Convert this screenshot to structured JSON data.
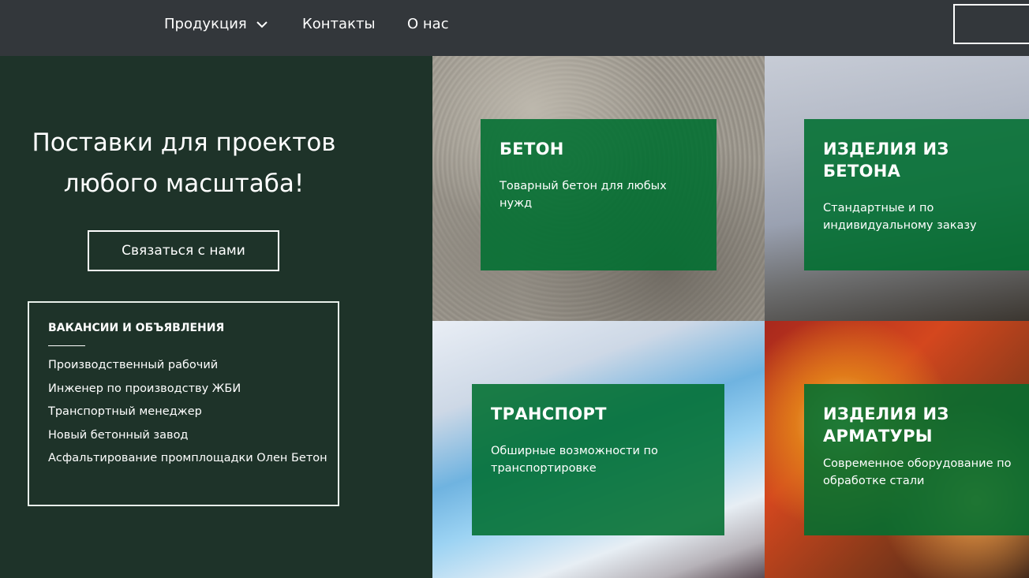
{
  "nav": {
    "products": "Продукция",
    "contacts": "Контакты",
    "about": "О нас"
  },
  "hero": {
    "title_line1": "Поставки для проектов",
    "title_line2": "любого масштаба!",
    "cta": "Связаться с нами"
  },
  "vacancies": {
    "title": "ВАКАНСИИ И ОБЪЯВЛЕНИЯ",
    "items": [
      "Производственный рабочий",
      "Инженер по производству ЖБИ",
      "Транспортный менеджер",
      "Новый бетонный завод",
      "Асфальтирование промплощадки Олен Бетон"
    ]
  },
  "tiles": {
    "concrete": {
      "title": "БЕТОН",
      "desc": "Товарный бетон для любых нужд"
    },
    "products": {
      "title": "ИЗДЕЛИЯ ИЗ БЕТОНА",
      "desc": "Стандартные и по индивидуальному заказу"
    },
    "transport": {
      "title": "ТРАНСПОРТ",
      "desc": "Обширные возможности по транспортировке"
    },
    "rebar": {
      "title": "ИЗДЕЛИЯ ИЗ АРМАТУРЫ",
      "desc": "Современное оборудование по обработке стали"
    }
  },
  "colors": {
    "nav_bg": "#33373b",
    "panel_bg": "#1e3329",
    "card_green": "#006e30"
  }
}
